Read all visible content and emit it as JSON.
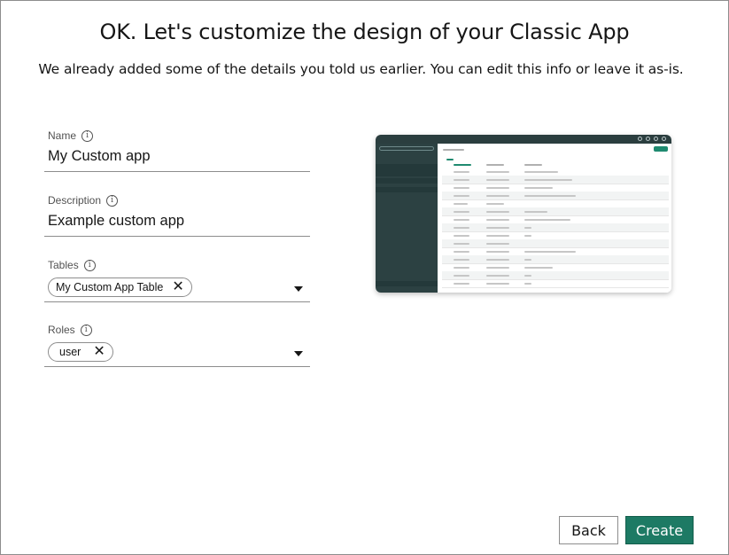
{
  "header": {
    "title": "OK. Let's customize the design of your Classic App",
    "subtitle": "We already added some of the details you told us earlier. You can edit this info or leave it as-is."
  },
  "form": {
    "name": {
      "label": "Name",
      "value": "My Custom app"
    },
    "description": {
      "label": "Description",
      "value": "Example custom app"
    },
    "tables": {
      "label": "Tables",
      "tags": [
        "My Custom App Table"
      ]
    },
    "roles": {
      "label": "Roles",
      "tags": [
        "user"
      ]
    }
  },
  "preview": {
    "description": "app-preview-thumbnail"
  },
  "footer": {
    "back_label": "Back",
    "create_label": "Create"
  },
  "colors": {
    "primary": "#1d7a64",
    "preview_sidebar": "#2c4142"
  },
  "icons": {
    "info": "info-icon",
    "remove": "close-icon",
    "dropdown": "chevron-down-icon"
  }
}
